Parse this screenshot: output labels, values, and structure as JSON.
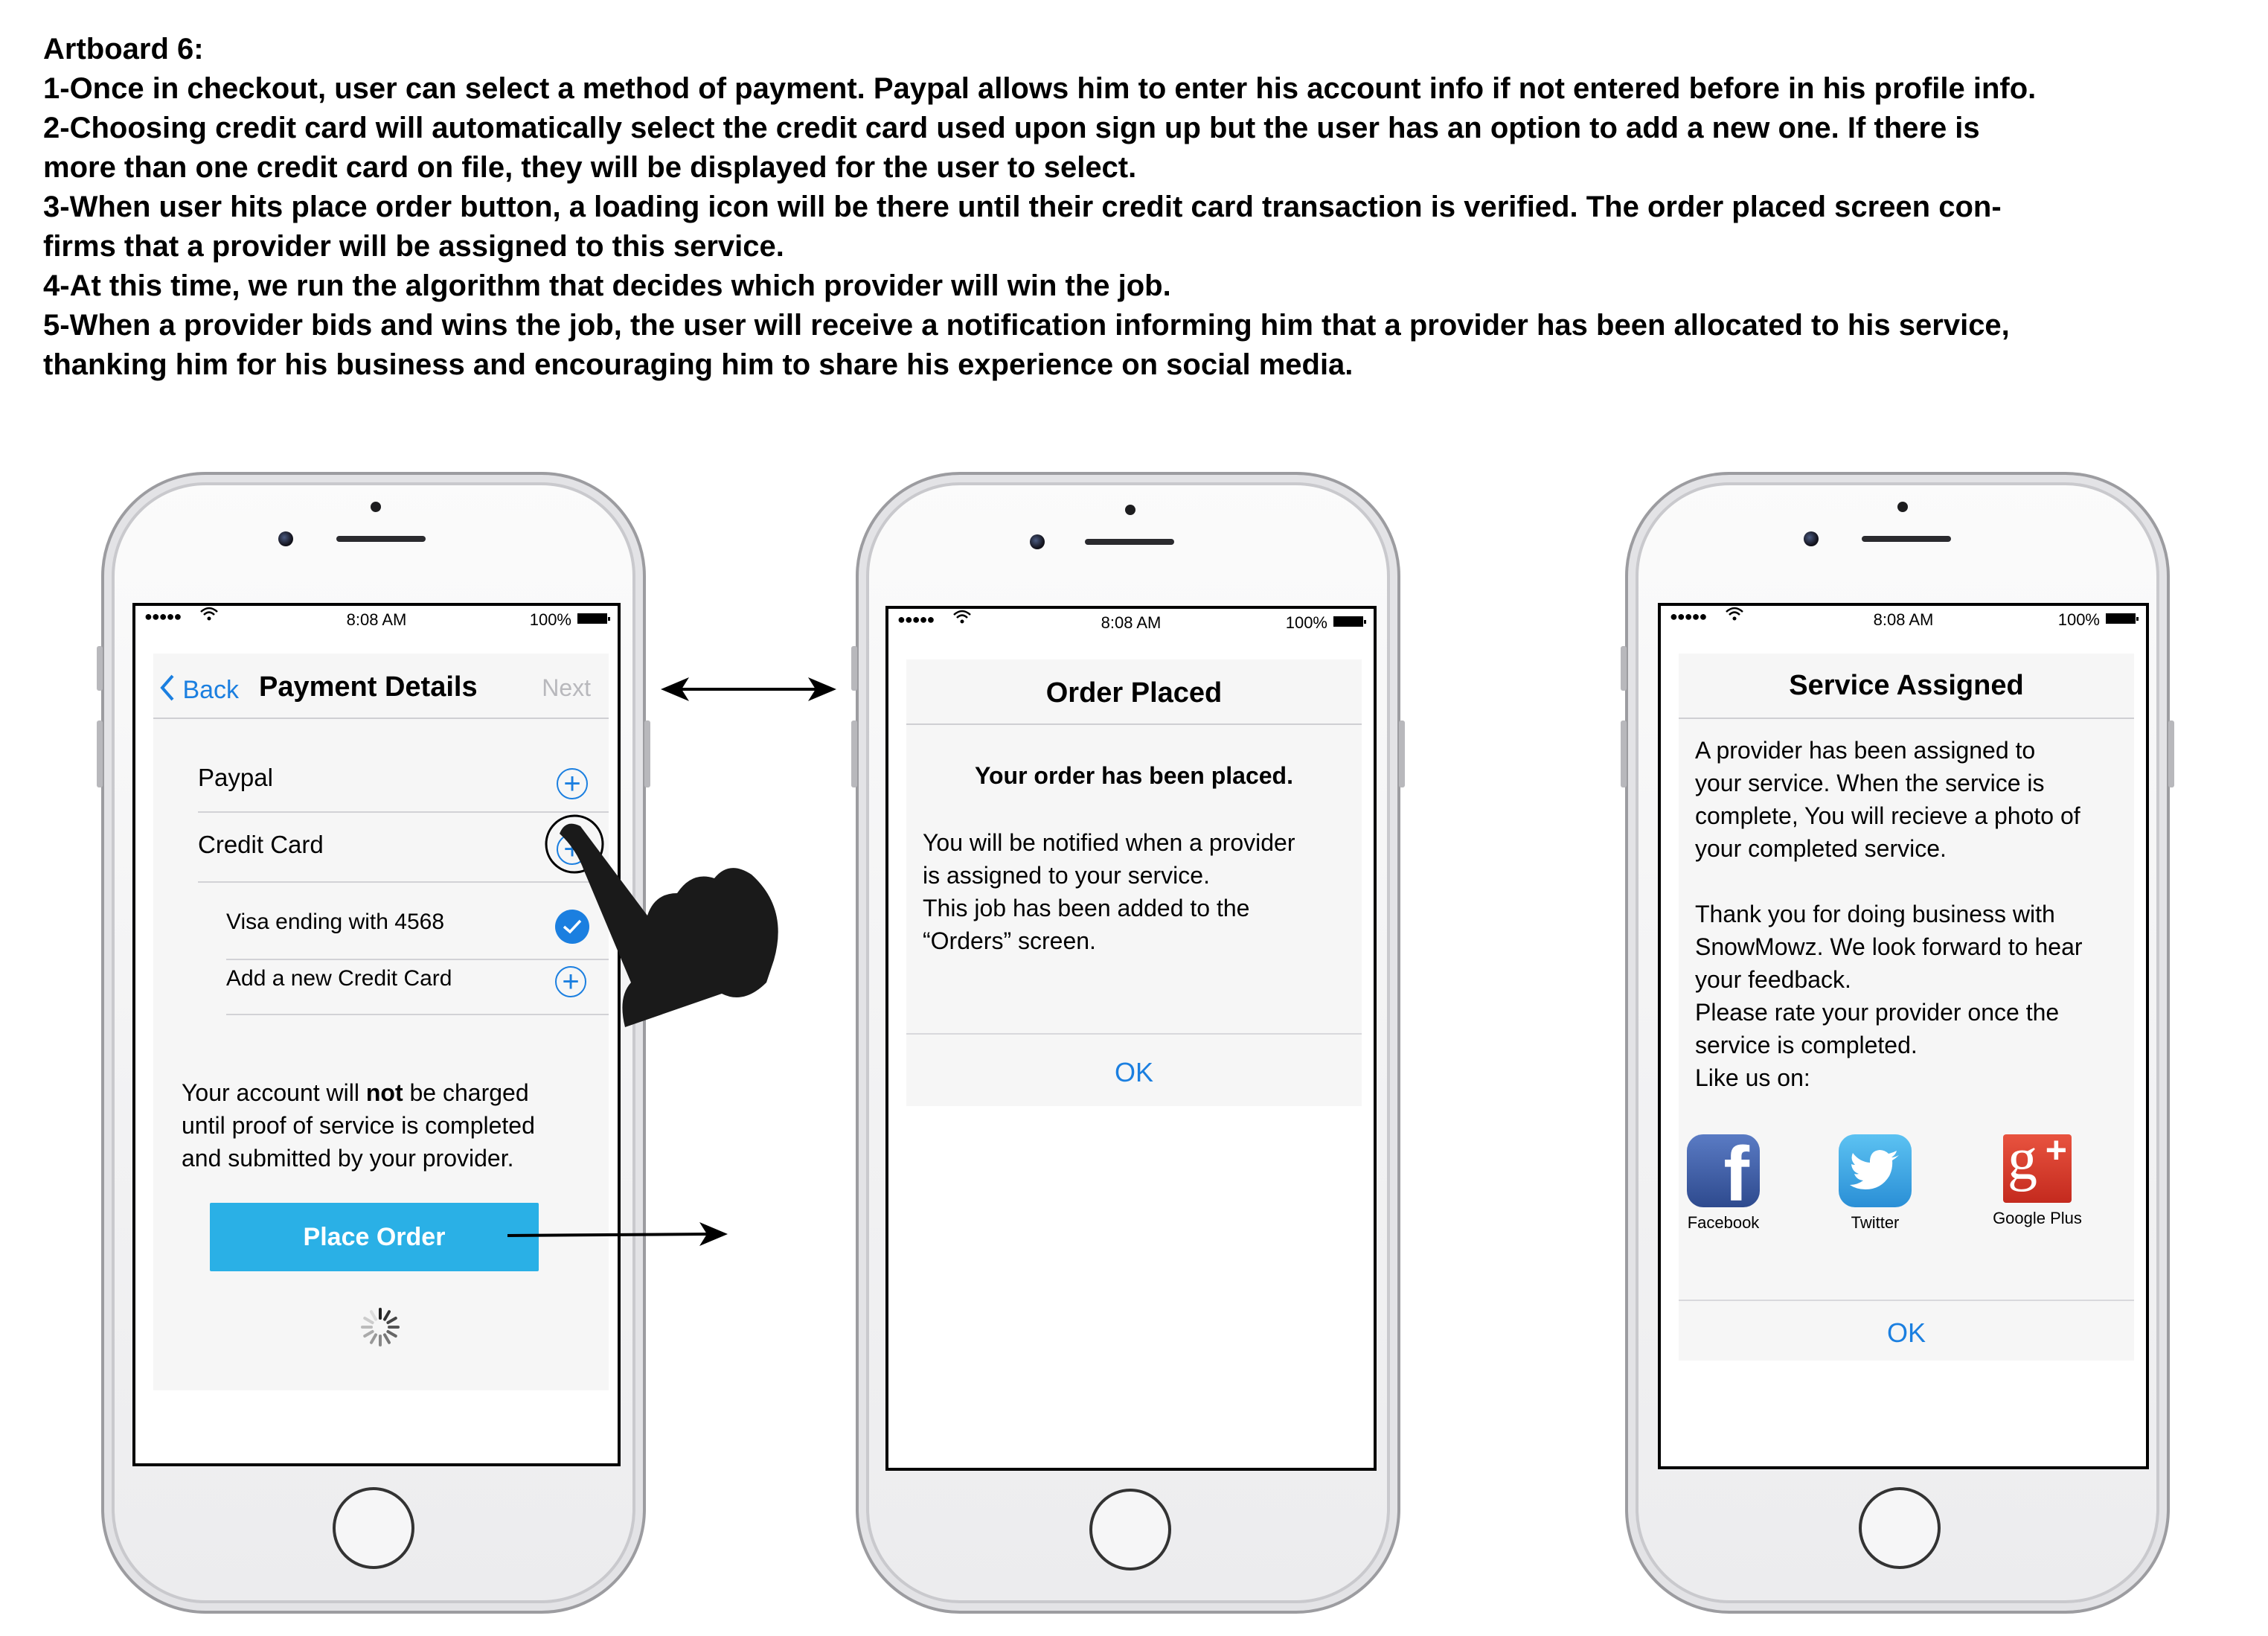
{
  "artboard": {
    "title": "Artboard 6:",
    "lines": [
      "1-Once in checkout, user can select a method of payment. Paypal allows him to enter his account info if not entered before in his profile info.",
      "2-Choosing credit card will automatically select the credit card used upon sign up but the user has an option to add a new one. If there is",
      "more than one credit card on file, they will be displayed for the user to select.",
      "3-When user hits place order button, a loading icon will be there until their credit card transaction is verified. The order placed screen con-",
      "firms that a provider will be assigned to this service.",
      "4-At this time, we run the algorithm that decides which provider will win the job.",
      "5-When a provider bids and wins the job, the user will receive a notification informing him that a provider has been allocated to his service,",
      "thanking him for his business and encouraging him to share his experience on social media."
    ]
  },
  "status_bar": {
    "signal": "●●●●●",
    "time": "8:08 AM",
    "battery": "100%"
  },
  "screen1": {
    "back": "Back",
    "title": "Payment Details",
    "next": "Next",
    "paypal": "Paypal",
    "credit_card": "Credit Card",
    "visa": "Visa ending with 4568",
    "add_card": "Add a new Credit Card",
    "note_prefix": "Your account will ",
    "note_bold": "not",
    "note_suffix": " be charged",
    "note_line2": "until proof of service is completed",
    "note_line3": "and submitted by your provider.",
    "place_order": "Place Order"
  },
  "screen2": {
    "title": "Order Placed",
    "heading": "Your order has been placed.",
    "lines": [
      "You will be notified when a provider",
      "is assigned to your service.",
      "This job has been added to the",
      "“Orders” screen."
    ],
    "ok": "OK"
  },
  "screen3": {
    "title": "Service Assigned",
    "para1": [
      "A provider has been assigned to",
      "your service. When the service is",
      "complete, You will recieve a photo of",
      "your completed service."
    ],
    "para2": [
      "Thank you for doing business with",
      "SnowMowz. We look forward to hear",
      "your feedback.",
      "Please rate your provider once the",
      "service is completed.",
      "Like us on:"
    ],
    "facebook": "Facebook",
    "twitter": "Twitter",
    "google": "Google Plus",
    "ok": "OK"
  },
  "colors": {
    "accent": "#1b7fe0",
    "button": "#2ab0e6",
    "panel": "#f6f6f6",
    "facebook": "#3b5998",
    "twitter": "#37a4e6",
    "google": "#d8382c"
  }
}
